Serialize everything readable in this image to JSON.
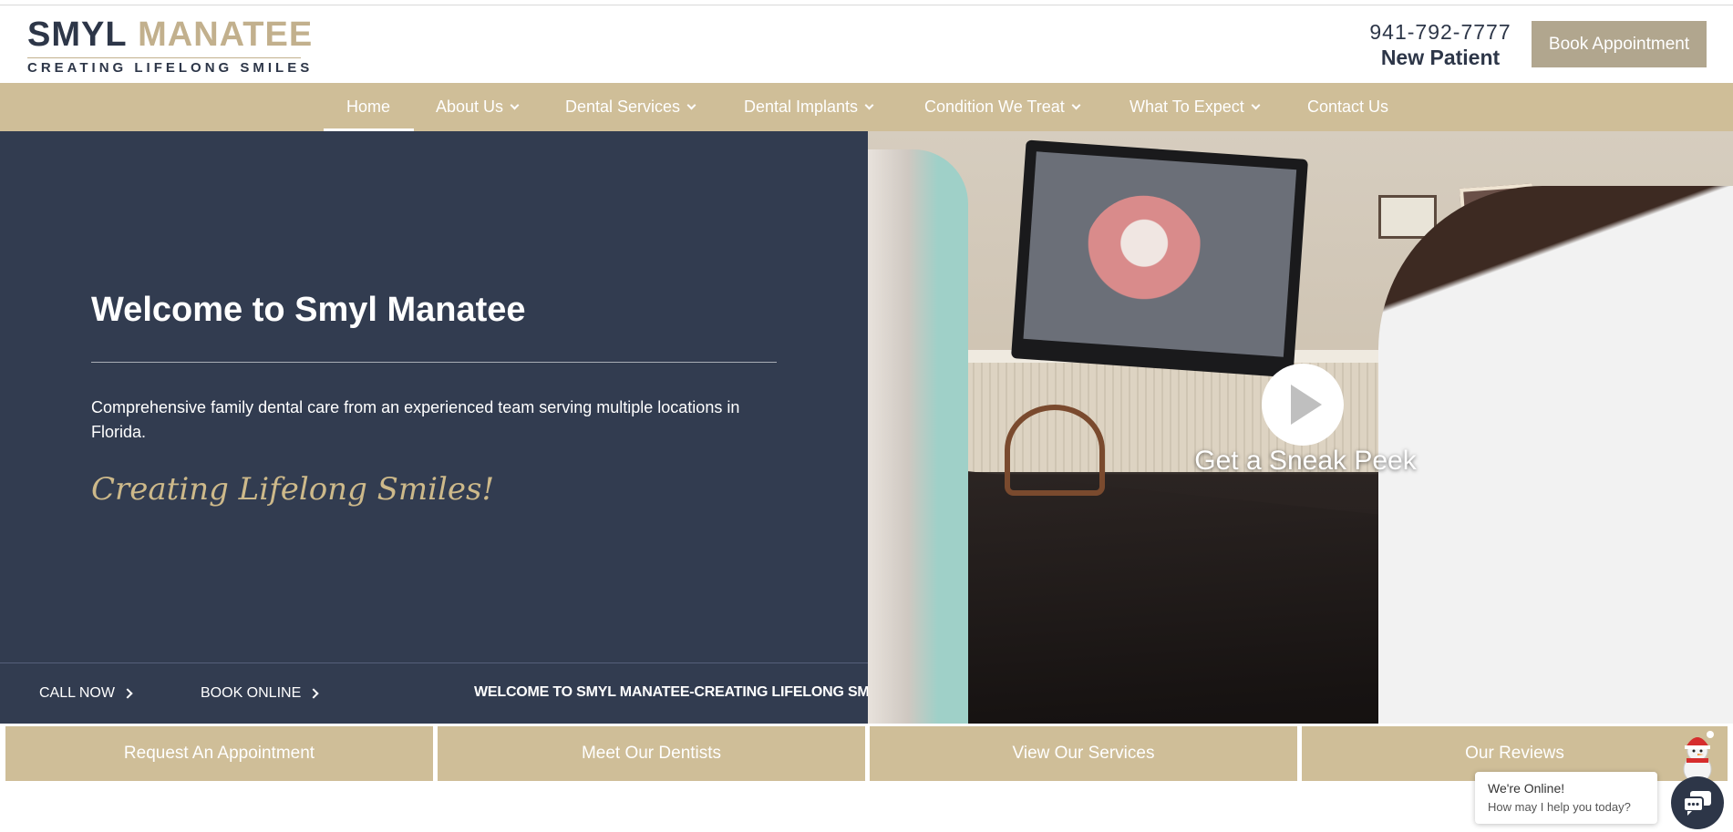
{
  "header": {
    "logo_word1": "SMYL",
    "logo_word2": "MANATEE",
    "logo_tagline": "CREATING LIFELONG SMILES",
    "phone": "941-792-7777",
    "new_patient": "New Patient",
    "book_button": "Book Appointment"
  },
  "nav": {
    "items": [
      {
        "label": "Home",
        "has_dropdown": false,
        "active": true
      },
      {
        "label": "About Us",
        "has_dropdown": true
      },
      {
        "label": "Dental Services",
        "has_dropdown": true
      },
      {
        "label": "Dental Implants",
        "has_dropdown": true
      },
      {
        "label": "Condition We Treat",
        "has_dropdown": true
      },
      {
        "label": "What To Expect",
        "has_dropdown": true
      },
      {
        "label": "Contact Us",
        "has_dropdown": false
      }
    ]
  },
  "hero": {
    "title": "Welcome to Smyl Manatee",
    "description": "Comprehensive family dental care from an experienced team serving multiple locations in Florida.",
    "script_text": "Creating Lifelong Smiles!",
    "cta_call": "CALL NOW",
    "cta_book": "BOOK ONLINE",
    "marquee": "WELCOME TO SMYL MANATEE-CREATING LIFELONG SMILES",
    "video_caption": "Get a Sneak Peek"
  },
  "quick_links": [
    {
      "label": "Request An Appointment"
    },
    {
      "label": "Meet Our Dentists"
    },
    {
      "label": "View Our Services"
    },
    {
      "label": "Our Reviews"
    }
  ],
  "chat": {
    "status": "We're Online!",
    "prompt": "How may I help you today?"
  },
  "colors": {
    "navy": "#323c50",
    "gold": "#cfbe98",
    "button_taupe": "#b1a68e",
    "script_gold": "#cdb98a"
  }
}
